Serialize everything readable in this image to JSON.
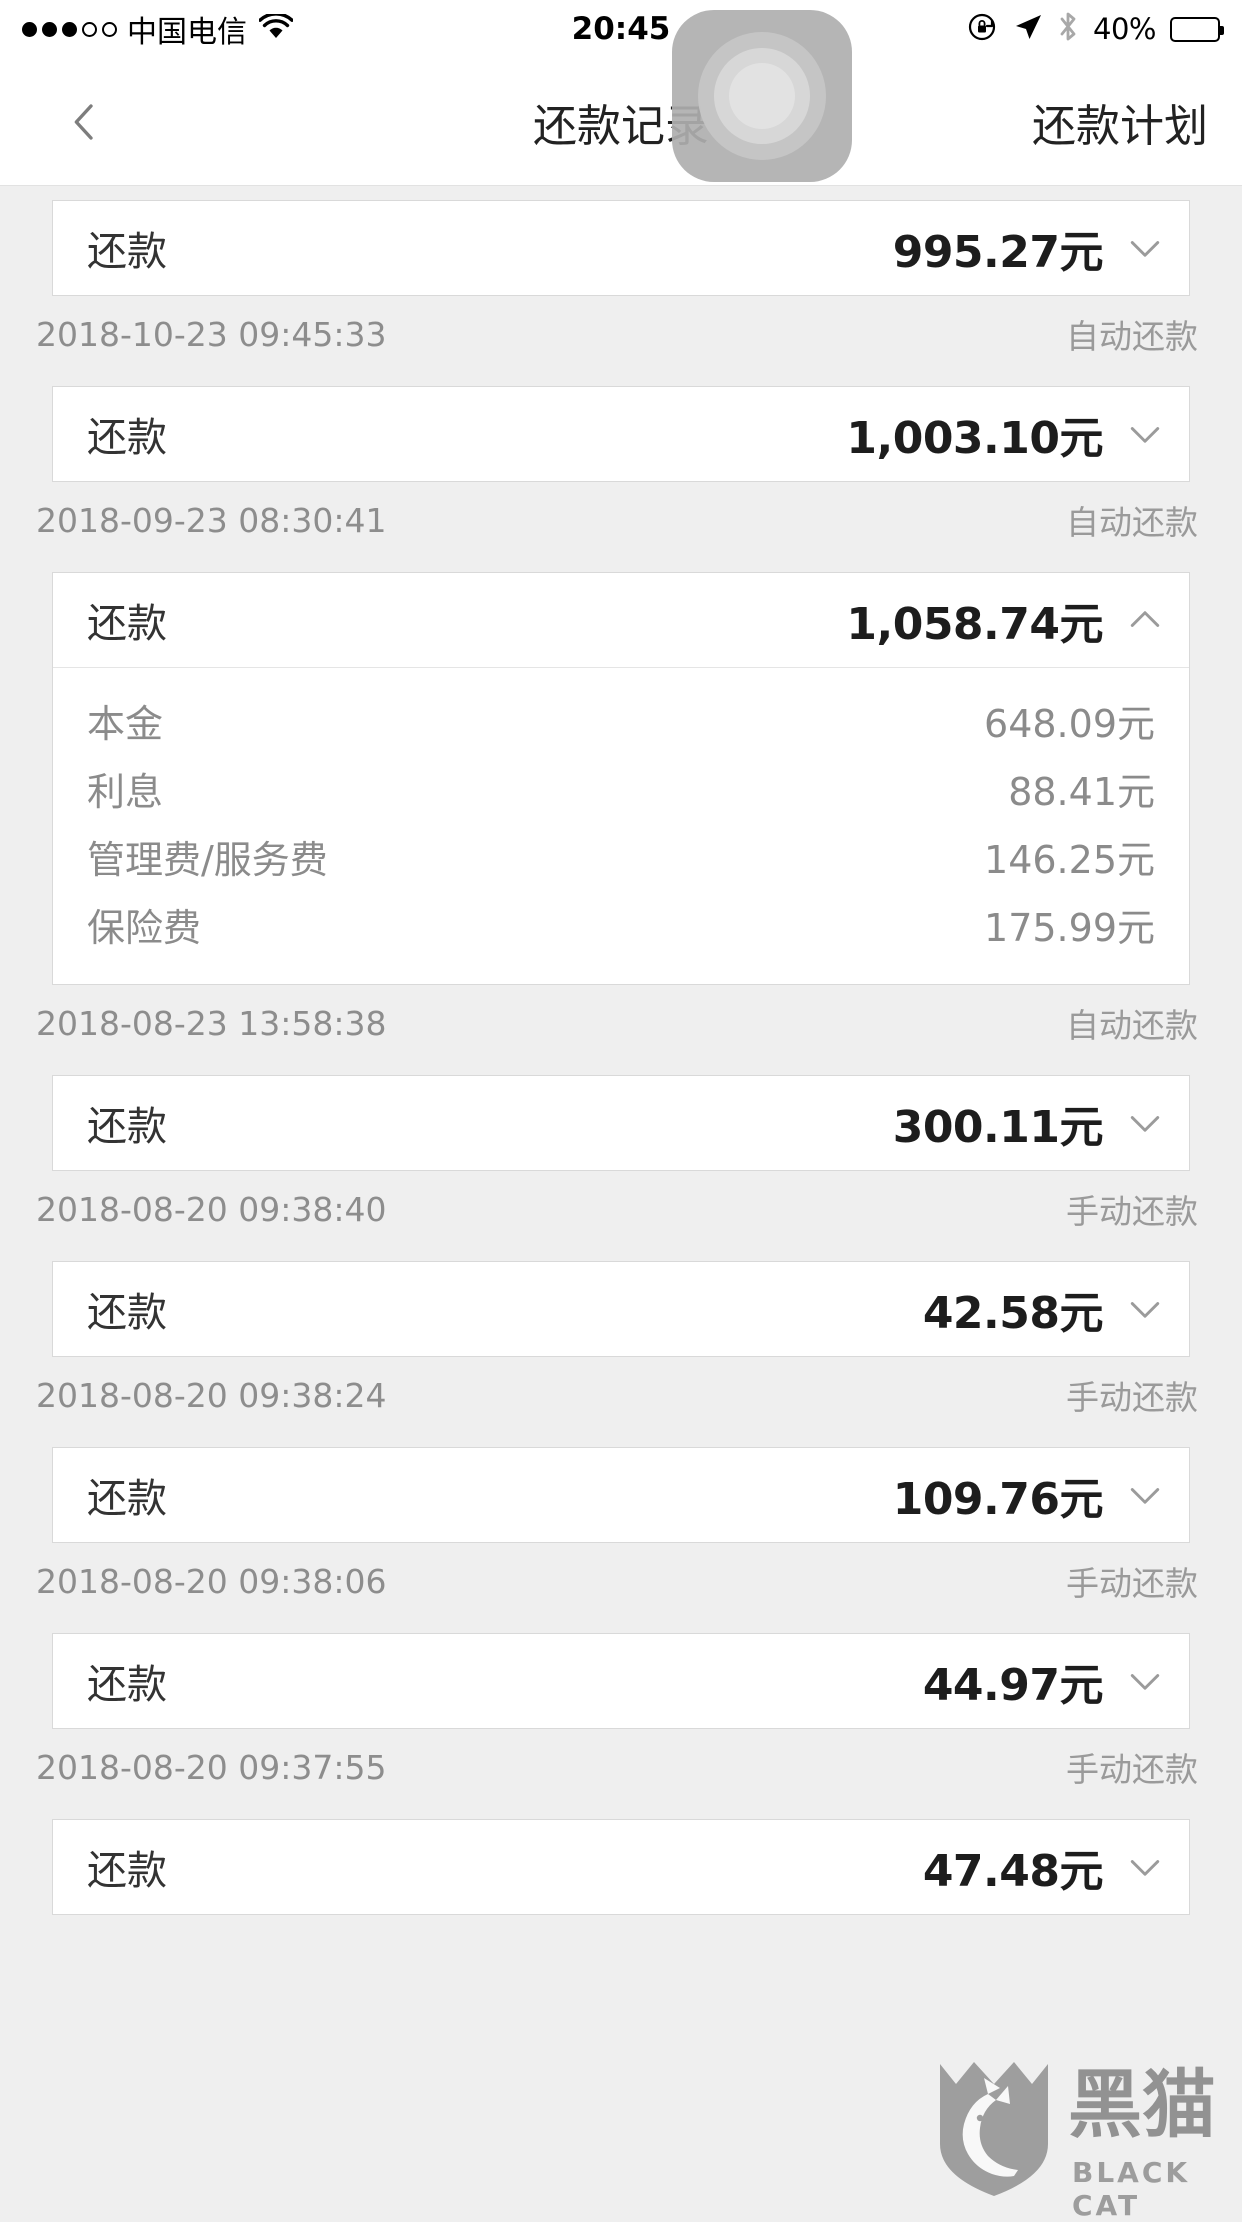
{
  "status_bar": {
    "signal_dots_filled": 3,
    "signal_dots_total": 5,
    "carrier": "中国电信",
    "wifi_icon": "wifi-icon",
    "time": "20:45",
    "rotation_lock_icon": "rotation-lock-icon",
    "location_icon": "location-arrow-icon",
    "bluetooth_icon": "bluetooth-icon",
    "battery_percent": "40%",
    "battery_level": 40
  },
  "nav_bar": {
    "back_icon": "chevron-left-icon",
    "title": "还款记录",
    "right_button": "还款计划"
  },
  "assistive_touch": {
    "icon": "assistive-touch-icon"
  },
  "watermark": {
    "cn": "黑猫",
    "en": "BLACK CAT",
    "icon": "black-cat-shield-icon"
  },
  "list": {
    "row_label": "还款",
    "currency_suffix": "元",
    "chevron_down_icon": "chevron-down-icon",
    "chevron_up_icon": "chevron-up-icon",
    "items": [
      {
        "label": "还款",
        "amount": "995.27元",
        "expanded": false,
        "chevron": "chevron-down-icon",
        "time": "2018-10-23 09:45:33",
        "type": "自动还款",
        "details": []
      },
      {
        "label": "还款",
        "amount": "1,003.10元",
        "expanded": false,
        "chevron": "chevron-down-icon",
        "time": "2018-09-23 08:30:41",
        "type": "自动还款",
        "details": []
      },
      {
        "label": "还款",
        "amount": "1,058.74元",
        "expanded": true,
        "chevron": "chevron-up-icon",
        "time": "2018-08-23 13:58:38",
        "type": "自动还款",
        "details": [
          {
            "label": "本金",
            "value": "648.09元"
          },
          {
            "label": "利息",
            "value": "88.41元"
          },
          {
            "label": "管理费/服务费",
            "value": "146.25元"
          },
          {
            "label": "保险费",
            "value": "175.99元"
          }
        ]
      },
      {
        "label": "还款",
        "amount": "300.11元",
        "expanded": false,
        "chevron": "chevron-down-icon",
        "time": "2018-08-20 09:38:40",
        "type": "手动还款",
        "details": []
      },
      {
        "label": "还款",
        "amount": "42.58元",
        "expanded": false,
        "chevron": "chevron-down-icon",
        "time": "2018-08-20 09:38:24",
        "type": "手动还款",
        "details": []
      },
      {
        "label": "还款",
        "amount": "109.76元",
        "expanded": false,
        "chevron": "chevron-down-icon",
        "time": "2018-08-20 09:38:06",
        "type": "手动还款",
        "details": []
      },
      {
        "label": "还款",
        "amount": "44.97元",
        "expanded": false,
        "chevron": "chevron-down-icon",
        "time": "2018-08-20 09:37:55",
        "type": "手动还款",
        "details": []
      },
      {
        "label": "还款",
        "amount": "47.48元",
        "expanded": false,
        "chevron": "chevron-down-icon",
        "time": "",
        "type": "",
        "details": []
      }
    ]
  },
  "colors": {
    "background": "#efefef",
    "card": "#ffffff",
    "border": "#d9d9d9",
    "text_primary": "#222222",
    "text_muted": "#8d8d8d"
  }
}
